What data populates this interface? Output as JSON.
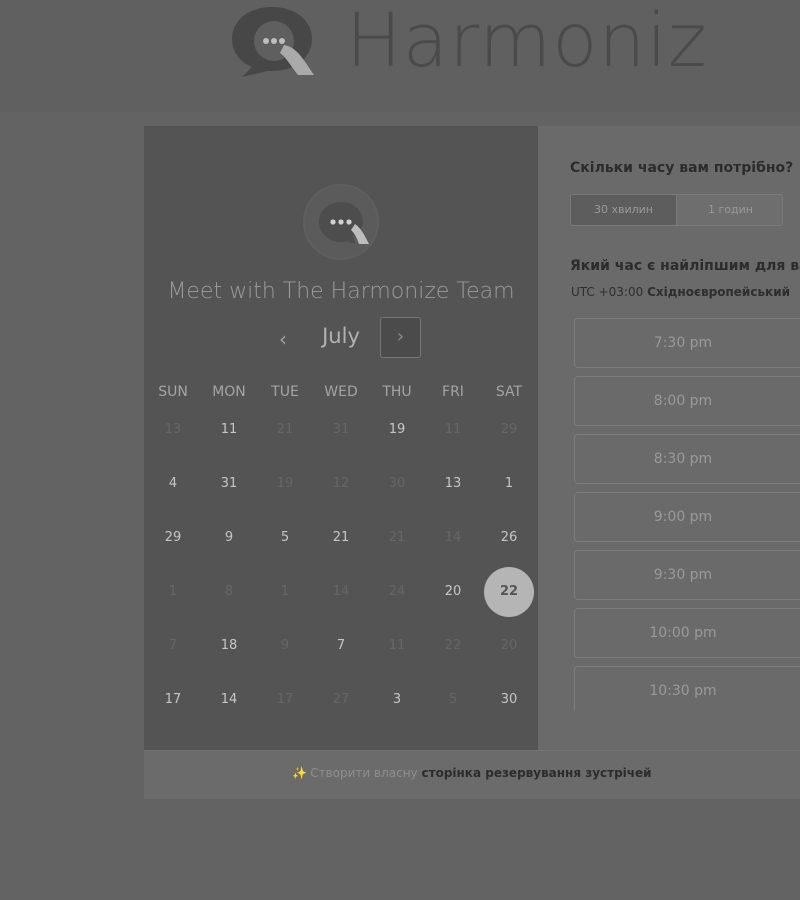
{
  "brand": {
    "name": "Harmoniz"
  },
  "calendar": {
    "title": "Meet with The Harmonize Team",
    "month": "July",
    "prev_icon": "‹",
    "next_icon": "›",
    "weekdays": [
      "SUN",
      "MON",
      "TUE",
      "WED",
      "THU",
      "FRI",
      "SAT"
    ],
    "weeks": [
      [
        {
          "d": "13",
          "on": false
        },
        {
          "d": "11",
          "on": true
        },
        {
          "d": "21",
          "on": false
        },
        {
          "d": "31",
          "on": false
        },
        {
          "d": "19",
          "on": true
        },
        {
          "d": "11",
          "on": false
        },
        {
          "d": "29",
          "on": false
        }
      ],
      [
        {
          "d": "4",
          "on": true
        },
        {
          "d": "31",
          "on": true
        },
        {
          "d": "19",
          "on": false
        },
        {
          "d": "12",
          "on": false
        },
        {
          "d": "30",
          "on": false
        },
        {
          "d": "13",
          "on": true
        },
        {
          "d": "1",
          "on": true
        }
      ],
      [
        {
          "d": "29",
          "on": true
        },
        {
          "d": "9",
          "on": true
        },
        {
          "d": "5",
          "on": true
        },
        {
          "d": "21",
          "on": true
        },
        {
          "d": "21",
          "on": false
        },
        {
          "d": "14",
          "on": false
        },
        {
          "d": "26",
          "on": true
        }
      ],
      [
        {
          "d": "1",
          "on": false
        },
        {
          "d": "8",
          "on": false
        },
        {
          "d": "1",
          "on": false
        },
        {
          "d": "14",
          "on": false
        },
        {
          "d": "24",
          "on": false
        },
        {
          "d": "20",
          "on": true
        },
        {
          "d": "22",
          "on": true,
          "selected": true
        }
      ],
      [
        {
          "d": "7",
          "on": false
        },
        {
          "d": "18",
          "on": true
        },
        {
          "d": "9",
          "on": false
        },
        {
          "d": "7",
          "on": true
        },
        {
          "d": "11",
          "on": false
        },
        {
          "d": "22",
          "on": false
        },
        {
          "d": "20",
          "on": false
        }
      ],
      [
        {
          "d": "17",
          "on": true
        },
        {
          "d": "14",
          "on": true
        },
        {
          "d": "17",
          "on": false
        },
        {
          "d": "27",
          "on": false
        },
        {
          "d": "3",
          "on": true
        },
        {
          "d": "5",
          "on": false
        },
        {
          "d": "30",
          "on": true
        }
      ]
    ]
  },
  "scheduler": {
    "duration_question": "Скільки часу вам потрібно?",
    "durations": [
      {
        "label": "30 хвилин",
        "active": true
      },
      {
        "label": "1 годин",
        "active": false
      }
    ],
    "time_question": "Який час є найліпшим для ва",
    "timezone_offset": "UTC +03:00",
    "timezone_name": "Східноєвропейський",
    "slots": [
      "7:30 pm",
      "8:00 pm",
      "8:30 pm",
      "9:00 pm",
      "9:30 pm",
      "10:00 pm",
      "10:30 pm"
    ]
  },
  "footer": {
    "prefix": "Створити власну",
    "link": "сторінка резервування зустрічей"
  },
  "colors": {
    "page_bg": "#636363",
    "calendar_bg": "#545454",
    "selected_day": "#b5b5b5"
  }
}
